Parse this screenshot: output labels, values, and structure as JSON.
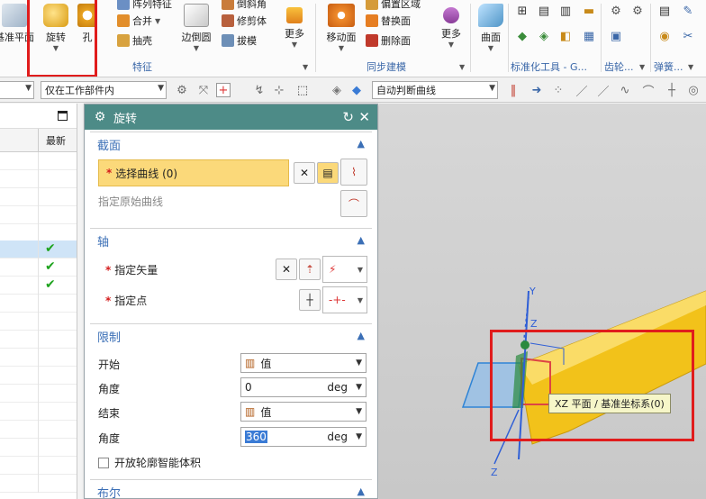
{
  "ribbon": {
    "datum_plane_label": "基准平面",
    "revolve_label": "旋转",
    "hole_label": "孔",
    "pattern_feature_label": "阵列特征",
    "combine_label": "合并",
    "shell_label": "抽壳",
    "edge_blend_label": "边倒圆",
    "chamfer_label": "倒斜角",
    "trim_body_label": "修剪体",
    "draft_label": "拔模",
    "more_label_1": "更多",
    "move_face_label": "移动面",
    "offset_region_label": "偏置区域",
    "replace_face_label": "替换面",
    "delete_face_label": "删除面",
    "more_label_2": "更多",
    "surface_label": "曲面",
    "group_feature": "特征",
    "group_sync": "同步建模",
    "group_std_tools": "标准化工具 - G...",
    "group_gear": "齿轮...",
    "group_spring": "弹簧..."
  },
  "toolbar": {
    "filter_combo": "",
    "scope_combo": "仅在工作部件内",
    "curve_rule_combo": "自动判断曲线"
  },
  "navigator": {
    "col_latest": "最新",
    "checked_rows": [
      true,
      true,
      true
    ]
  },
  "dialog": {
    "title": "旋转",
    "section_label": "截面",
    "select_curve": "选择曲线 (0)",
    "specify_origin_curve": "指定原始曲线",
    "axis_label": "轴",
    "specify_vector": "指定矢量",
    "specify_point": "指定点",
    "limits_label": "限制",
    "start_label": "开始",
    "start_type": "值",
    "start_angle_label": "角度",
    "start_angle_value": "0",
    "start_unit": "deg",
    "end_label": "结束",
    "end_type": "值",
    "end_angle_label": "角度",
    "end_angle_value": "360",
    "end_unit": "deg",
    "open_profile_checkbox": "开放轮廓智能体积",
    "boolean_label": "布尔"
  },
  "viewport": {
    "axis_y": "Y",
    "axis_z": "Z",
    "axis_z_lower": "Z",
    "tooltip": "XZ 平面 / 基准坐标系(0)"
  },
  "colors": {
    "dialog_title_bg": "#4d8b87",
    "section_header": "#3b6fb6",
    "selection_highlight": "#fbd97a",
    "annotation_red": "#e01c1c",
    "solid_body": "#f2c21a"
  }
}
